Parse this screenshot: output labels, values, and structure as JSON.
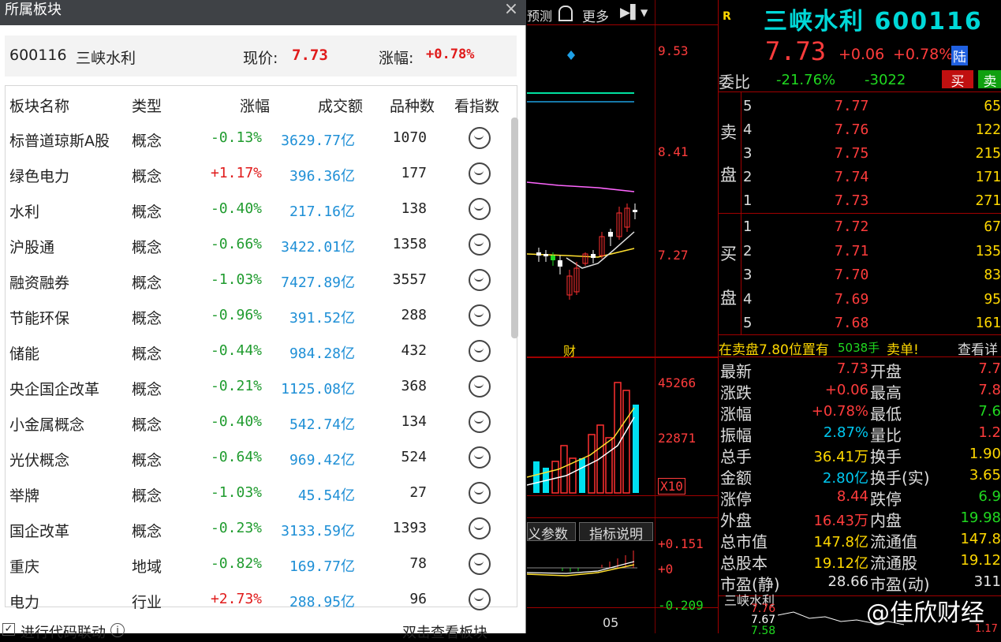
{
  "panel": {
    "title": "所属板块",
    "close": "×",
    "code": "600116",
    "name": "三峡水利",
    "price_label": "现价:",
    "price": "7.73",
    "change_label": "涨幅:",
    "change": "+0.78%",
    "headers": [
      "板块名称",
      "类型",
      "涨幅",
      "成交额",
      "品种数",
      "看指数"
    ],
    "rows": [
      {
        "name": "标普道琼斯A股",
        "type": "概念",
        "chg": "-0.13%",
        "amt": "3629.77亿",
        "count": "1070",
        "dir": "dn"
      },
      {
        "name": "绿色电力",
        "type": "概念",
        "chg": "+1.17%",
        "amt": "396.36亿",
        "count": "177",
        "dir": "up"
      },
      {
        "name": "水利",
        "type": "概念",
        "chg": "-0.40%",
        "amt": "217.16亿",
        "count": "138",
        "dir": "dn"
      },
      {
        "name": "沪股通",
        "type": "概念",
        "chg": "-0.66%",
        "amt": "3422.01亿",
        "count": "1358",
        "dir": "dn"
      },
      {
        "name": "融资融券",
        "type": "概念",
        "chg": "-1.03%",
        "amt": "7427.89亿",
        "count": "3557",
        "dir": "dn"
      },
      {
        "name": "节能环保",
        "type": "概念",
        "chg": "-0.96%",
        "amt": "391.52亿",
        "count": "288",
        "dir": "dn"
      },
      {
        "name": "储能",
        "type": "概念",
        "chg": "-0.44%",
        "amt": "984.28亿",
        "count": "432",
        "dir": "dn"
      },
      {
        "name": "央企国企改革",
        "type": "概念",
        "chg": "-0.21%",
        "amt": "1125.08亿",
        "count": "368",
        "dir": "dn"
      },
      {
        "name": "小金属概念",
        "type": "概念",
        "chg": "-0.40%",
        "amt": "542.74亿",
        "count": "134",
        "dir": "dn"
      },
      {
        "name": "光伏概念",
        "type": "概念",
        "chg": "-0.64%",
        "amt": "969.42亿",
        "count": "524",
        "dir": "dn"
      },
      {
        "name": "举牌",
        "type": "概念",
        "chg": "-1.03%",
        "amt": "45.54亿",
        "count": "27",
        "dir": "dn"
      },
      {
        "name": "国企改革",
        "type": "概念",
        "chg": "-0.23%",
        "amt": "3133.59亿",
        "count": "1393",
        "dir": "dn"
      },
      {
        "name": "重庆",
        "type": "地域",
        "chg": "-0.82%",
        "amt": "169.77亿",
        "count": "78",
        "dir": "dn"
      },
      {
        "name": "电力",
        "type": "行业",
        "chg": "+2.73%",
        "amt": "288.95亿",
        "count": "96",
        "dir": "up"
      }
    ],
    "footer_check": "✓",
    "footer_left": "进行代码联动",
    "footer_right": "双击查看板块"
  },
  "chart": {
    "toolbar": [
      "预测",
      "更多"
    ],
    "price_ticks": [
      "9.53",
      "8.41",
      "7.27"
    ],
    "vol_ticks": [
      "45266",
      "22871",
      "X10"
    ],
    "tabs": [
      "义参数",
      "指标说明"
    ],
    "ind_ticks": [
      "+0.151",
      "+0",
      "-0.209"
    ],
    "date_label": "05",
    "event_label": "财"
  },
  "quote": {
    "badge": "R",
    "title": "三峡水利 600116",
    "price": "7.73",
    "change": "+0.06",
    "change_pct": "+0.78%",
    "lu": "陆",
    "webi_label": "委比",
    "webi": "-21.76%",
    "wecha": "-3022",
    "buy_btn": "买",
    "sell_btn": "卖",
    "sell_label": [
      "卖",
      "盘"
    ],
    "buy_label": [
      "买",
      "盘"
    ],
    "sells": [
      {
        "lvl": "5",
        "price": "7.77",
        "vol": "65"
      },
      {
        "lvl": "4",
        "price": "7.76",
        "vol": "122"
      },
      {
        "lvl": "3",
        "price": "7.75",
        "vol": "215"
      },
      {
        "lvl": "2",
        "price": "7.74",
        "vol": "171"
      },
      {
        "lvl": "1",
        "price": "7.73",
        "vol": "271"
      }
    ],
    "buys": [
      {
        "lvl": "1",
        "price": "7.72",
        "vol": "67"
      },
      {
        "lvl": "2",
        "price": "7.71",
        "vol": "135"
      },
      {
        "lvl": "3",
        "price": "7.70",
        "vol": "83"
      },
      {
        "lvl": "4",
        "price": "7.69",
        "vol": "95"
      },
      {
        "lvl": "5",
        "price": "7.68",
        "vol": "161"
      }
    ],
    "notice": "在卖盘7.80位置有",
    "notice_vol": "5038手",
    "notice_tag": "卖单!",
    "notice_link": "查看详",
    "details": [
      {
        "l": "最新",
        "v": "7.73",
        "c": "red",
        "l2": "开盘",
        "v2": "7.7",
        "c2": "red"
      },
      {
        "l": "涨跌",
        "v": "+0.06",
        "c": "red",
        "l2": "最高",
        "v2": "7.8",
        "c2": "red"
      },
      {
        "l": "涨幅",
        "v": "+0.78%",
        "c": "red",
        "l2": "最低",
        "v2": "7.6",
        "c2": "grn"
      },
      {
        "l": "振幅",
        "v": "2.87%",
        "c": "cy",
        "l2": "量比",
        "v2": "1.2",
        "c2": "red"
      },
      {
        "l": "总手",
        "v": "36.41万",
        "c": "yel",
        "l2": "换手",
        "v2": "1.90",
        "c2": "yel"
      },
      {
        "l": "金额",
        "v": "2.80亿",
        "c": "cy",
        "l2": "换手(实)",
        "v2": "3.65",
        "c2": "yel"
      },
      {
        "l": "涨停",
        "v": "8.44",
        "c": "red",
        "l2": "跌停",
        "v2": "6.9",
        "c2": "grn"
      },
      {
        "l": "外盘",
        "v": "16.43万",
        "c": "red",
        "l2": "内盘",
        "v2": "19.98",
        "c2": "grn"
      },
      {
        "l": "总市值",
        "v": "147.8亿",
        "c": "yel",
        "l2": "流通值",
        "v2": "147.8",
        "c2": "yel"
      },
      {
        "l": "总股本",
        "v": "19.12亿",
        "c": "yel",
        "l2": "流通股",
        "v2": "19.12",
        "c2": "yel"
      },
      {
        "l": "市盈(静)",
        "v": "28.66",
        "c": "wht",
        "l2": "市盈(动)",
        "v2": "311",
        "c2": "wht"
      }
    ],
    "mini_name": "三峡水利",
    "mini_prices": [
      "7.76",
      "7.67",
      "7.58"
    ],
    "mini_right": "1.17"
  },
  "watermark": "@佳欣财经"
}
